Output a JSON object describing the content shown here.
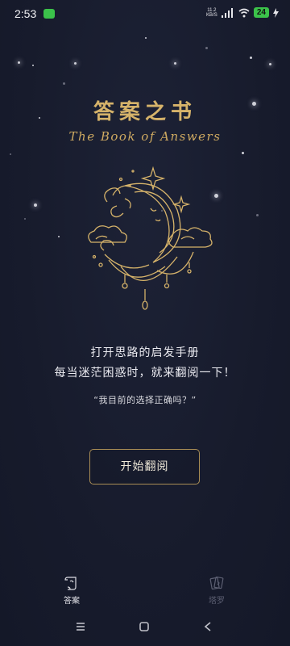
{
  "status_bar": {
    "time": "2:53",
    "net_speed": "11.2",
    "net_unit": "KB/S",
    "battery": "24",
    "app_icon": "wechat-icon"
  },
  "title": "答案之书",
  "subtitle": "The Book of Answers",
  "description": {
    "line1": "打开思路的启发手册",
    "line2": "每当迷茫困惑时，就来翻阅一下！"
  },
  "sample_question": "“我目前的选择正确吗？”",
  "start_button": "开始翻阅",
  "tabs": [
    {
      "label": "答案",
      "icon": "book-scroll-icon",
      "active": true
    },
    {
      "label": "塔罗",
      "icon": "tarot-cards-icon",
      "active": false
    }
  ],
  "nav": {
    "menu": "≡",
    "home": "□",
    "back": "<"
  },
  "colors": {
    "background": "#181c2e",
    "gold": "#d6b36a",
    "button_border": "#a98d55"
  }
}
